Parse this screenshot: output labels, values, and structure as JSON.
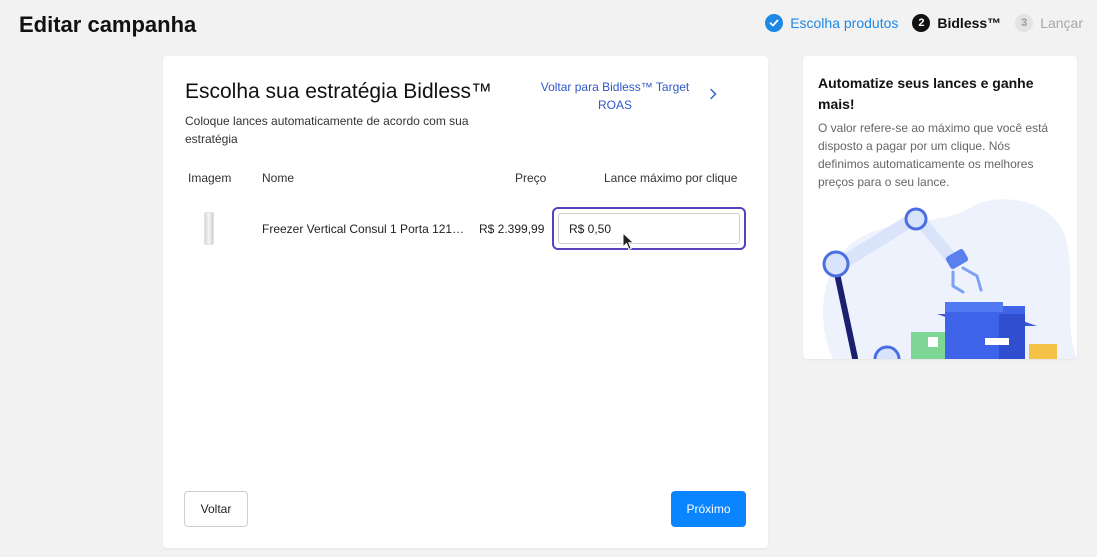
{
  "page": {
    "title": "Editar campanha"
  },
  "stepper": {
    "steps": [
      {
        "num": "",
        "label": "Escolha produtos",
        "state": "done"
      },
      {
        "num": "2",
        "label": "Bidless™",
        "state": "active"
      },
      {
        "num": "3",
        "label": "Lançar",
        "state": "pending"
      }
    ]
  },
  "strategy": {
    "title": "Escolha sua estratégia Bidless™",
    "subtitle": "Coloque lances automaticamente de acordo com sua estratégia",
    "back_link": "Voltar para Bidless™ Target ROAS"
  },
  "table": {
    "headers": {
      "image": "Imagem",
      "name": "Nome",
      "price": "Preço",
      "bid": "Lance máximo por clique"
    },
    "rows": [
      {
        "name": "Freezer Vertical Consul 1 Porta 121L ...",
        "price": "R$ 2.399,99",
        "bid": "R$ 0,50"
      }
    ]
  },
  "actions": {
    "back": "Voltar",
    "next": "Próximo"
  },
  "sidebar": {
    "title": "Automatize seus lances e ganhe mais!",
    "text": "O valor refere-se ao máximo que você está disposto a pagar por um clique. Nós definimos automaticamente os melhores preços para o seu lance."
  },
  "colors": {
    "accent_blue": "#1e88e5",
    "link_blue": "#2f57c8",
    "primary_button": "#0a84ff",
    "input_focus": "#5a3fbf"
  },
  "icons": {
    "step_done": "check-circle-icon",
    "back_link": "chevron-right-icon",
    "cursor": "mouse-cursor-icon"
  }
}
